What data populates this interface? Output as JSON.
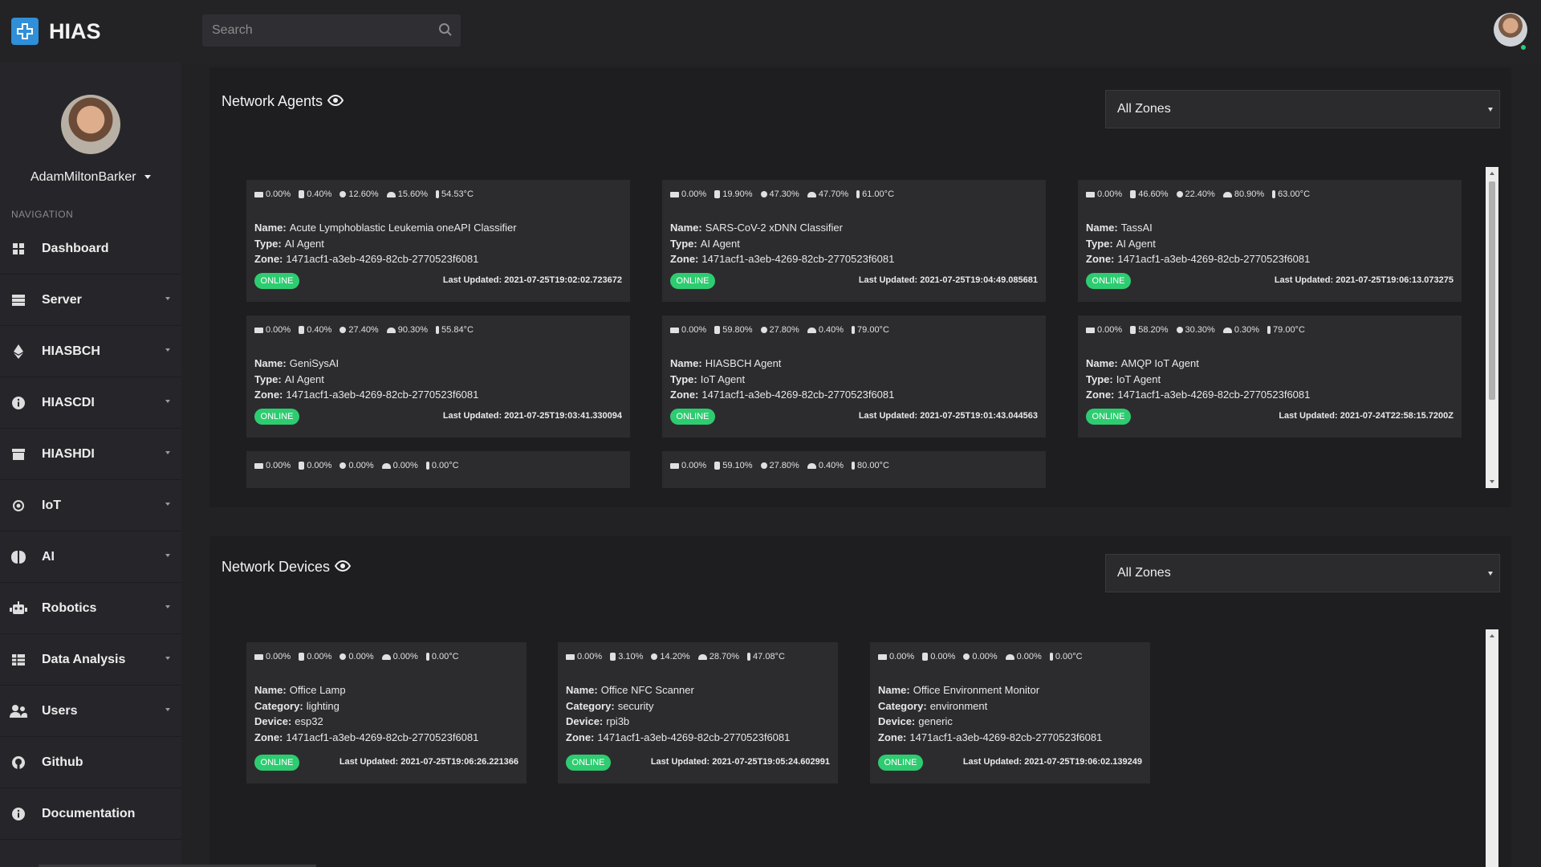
{
  "app": {
    "title": "HIAS"
  },
  "search": {
    "placeholder": "Search"
  },
  "user": {
    "name": "AdamMiltonBarker"
  },
  "sidebar": {
    "section_label": "NAVIGATION",
    "items": [
      {
        "label": "Dashboard",
        "icon": "dashboard-icon",
        "caret": false
      },
      {
        "label": "Server",
        "icon": "server-icon",
        "caret": true
      },
      {
        "label": "HIASBCH",
        "icon": "ethereum-icon",
        "caret": true
      },
      {
        "label": "HIASCDI",
        "icon": "info-icon",
        "caret": true
      },
      {
        "label": "HIASHDI",
        "icon": "archive-icon",
        "caret": true
      },
      {
        "label": "IoT",
        "icon": "iot-icon",
        "caret": true
      },
      {
        "label": "AI",
        "icon": "brain-icon",
        "caret": true
      },
      {
        "label": "Robotics",
        "icon": "robot-icon",
        "caret": true
      },
      {
        "label": "Data Analysis",
        "icon": "table-icon",
        "caret": true
      },
      {
        "label": "Users",
        "icon": "users-icon",
        "caret": true
      },
      {
        "label": "Github",
        "icon": "github-icon",
        "caret": false
      },
      {
        "label": "Documentation",
        "icon": "info-icon",
        "caret": false
      }
    ]
  },
  "agents_panel": {
    "title": "Network Agents",
    "zone_select": "All Zones",
    "cards": [
      {
        "stats": [
          "0.00%",
          "0.40%",
          "12.60%",
          "15.60%",
          "54.53°C"
        ],
        "name": "Acute Lymphoblastic Leukemia oneAPI Classifier",
        "type": "AI Agent",
        "zone": "1471acf1-a3eb-4269-82cb-2770523f6081",
        "status": "ONLINE",
        "updated": "Last Updated: 2021-07-25T19:02:02.723672"
      },
      {
        "stats": [
          "0.00%",
          "19.90%",
          "47.30%",
          "47.70%",
          "61.00°C"
        ],
        "name": "SARS-CoV-2 xDNN Classifier",
        "type": "AI Agent",
        "zone": "1471acf1-a3eb-4269-82cb-2770523f6081",
        "status": "ONLINE",
        "updated": "Last Updated: 2021-07-25T19:04:49.085681"
      },
      {
        "stats": [
          "0.00%",
          "46.60%",
          "22.40%",
          "80.90%",
          "63.00°C"
        ],
        "name": "TassAI",
        "type": "AI Agent",
        "zone": "1471acf1-a3eb-4269-82cb-2770523f6081",
        "status": "ONLINE",
        "updated": "Last Updated: 2021-07-25T19:06:13.073275"
      },
      {
        "stats": [
          "0.00%",
          "0.40%",
          "27.40%",
          "90.30%",
          "55.84°C"
        ],
        "name": "GeniSysAI",
        "type": "AI Agent",
        "zone": "1471acf1-a3eb-4269-82cb-2770523f6081",
        "status": "ONLINE",
        "updated": "Last Updated: 2021-07-25T19:03:41.330094"
      },
      {
        "stats": [
          "0.00%",
          "59.80%",
          "27.80%",
          "0.40%",
          "79.00°C"
        ],
        "name": "HIASBCH Agent",
        "type": "IoT Agent",
        "zone": "1471acf1-a3eb-4269-82cb-2770523f6081",
        "status": "ONLINE",
        "updated": "Last Updated: 2021-07-25T19:01:43.044563"
      },
      {
        "stats": [
          "0.00%",
          "58.20%",
          "30.30%",
          "0.30%",
          "79.00°C"
        ],
        "name": "AMQP IoT Agent",
        "type": "IoT Agent",
        "zone": "1471acf1-a3eb-4269-82cb-2770523f6081",
        "status": "ONLINE",
        "updated": "Last Updated: 2021-07-24T22:58:15.7200Z"
      },
      {
        "stats": [
          "0.00%",
          "0.00%",
          "0.00%",
          "0.00%",
          "0.00°C"
        ]
      },
      {
        "stats": [
          "0.00%",
          "59.10%",
          "27.80%",
          "0.40%",
          "80.00°C"
        ]
      }
    ]
  },
  "devices_panel": {
    "title": "Network Devices",
    "zone_select": "All Zones",
    "cards": [
      {
        "stats": [
          "0.00%",
          "0.00%",
          "0.00%",
          "0.00%",
          "0.00°C"
        ],
        "name": "Office Lamp",
        "category": "lighting",
        "device": "esp32",
        "zone": "1471acf1-a3eb-4269-82cb-2770523f6081",
        "status": "ONLINE",
        "updated": "Last Updated: 2021-07-25T19:06:26.221366"
      },
      {
        "stats": [
          "0.00%",
          "3.10%",
          "14.20%",
          "28.70%",
          "47.08°C"
        ],
        "name": "Office NFC Scanner",
        "category": "security",
        "device": "rpi3b",
        "zone": "1471acf1-a3eb-4269-82cb-2770523f6081",
        "status": "ONLINE",
        "updated": "Last Updated: 2021-07-25T19:05:24.602991"
      },
      {
        "stats": [
          "0.00%",
          "0.00%",
          "0.00%",
          "0.00%",
          "0.00°C"
        ],
        "name": "Office Environment Monitor",
        "category": "environment",
        "device": "generic",
        "zone": "1471acf1-a3eb-4269-82cb-2770523f6081",
        "status": "ONLINE",
        "updated": "Last Updated: 2021-07-25T19:06:02.139249"
      }
    ]
  },
  "labels": {
    "name": "Name:",
    "type": "Type:",
    "zone": "Zone:",
    "category": "Category:",
    "device": "Device:"
  },
  "colors": {
    "online": "#2ecc71",
    "accent": "#2f8fd8"
  }
}
